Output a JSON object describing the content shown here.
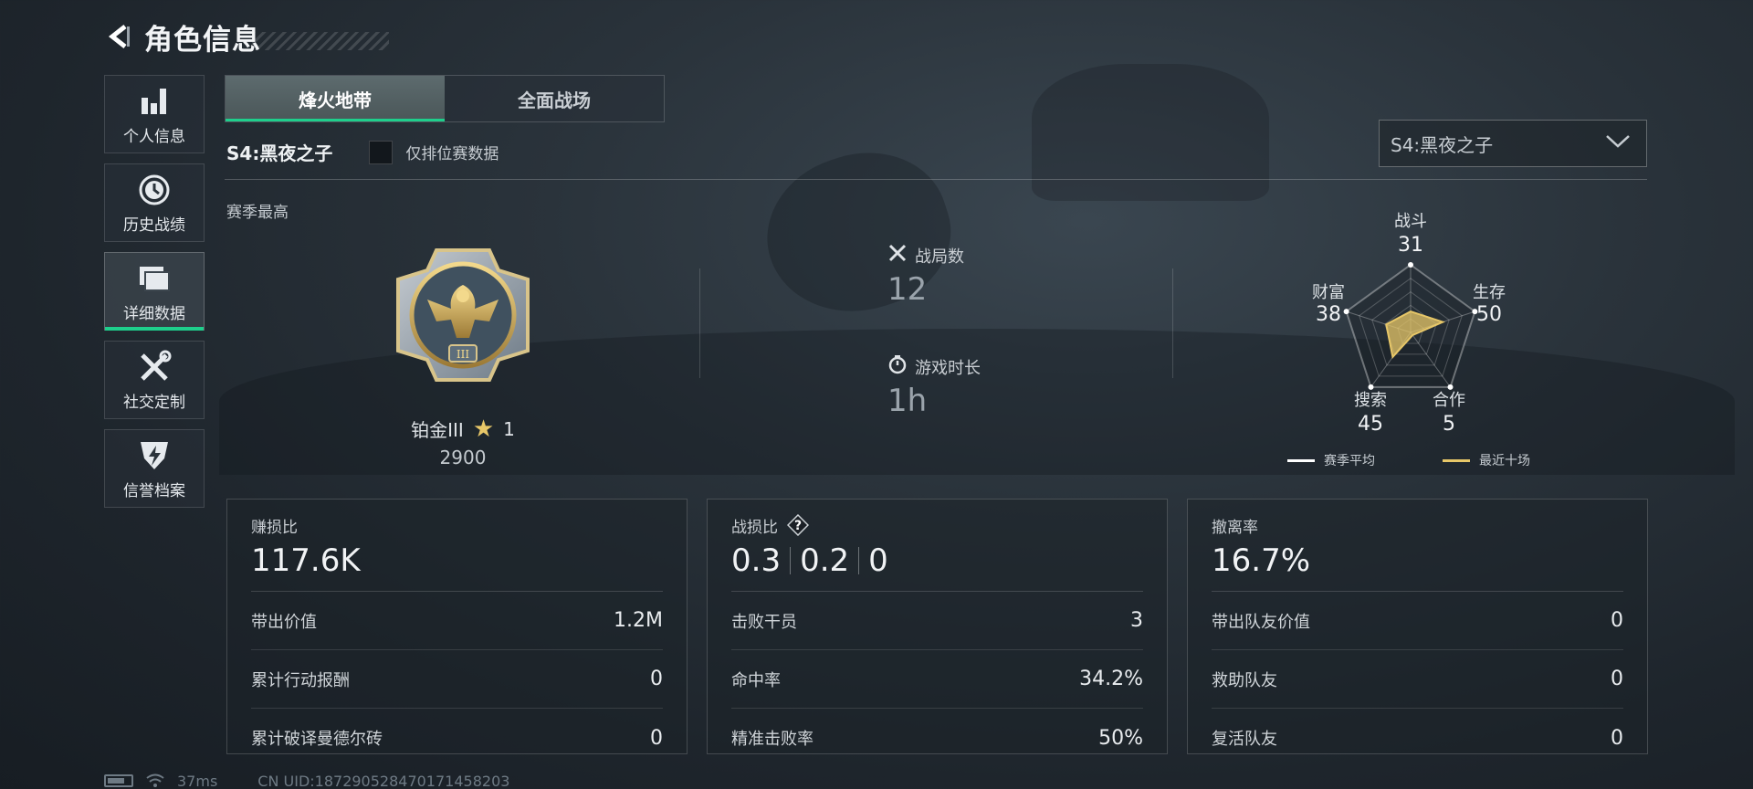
{
  "header": {
    "title": "角色信息"
  },
  "sidenav": [
    {
      "label": "个人信息",
      "icon": "bar-chart-icon"
    },
    {
      "label": "历史战绩",
      "icon": "history-clock-icon"
    },
    {
      "label": "详细数据",
      "icon": "folder-stack-icon",
      "active": true
    },
    {
      "label": "社交定制",
      "icon": "tools-icon"
    },
    {
      "label": "信誉档案",
      "icon": "shield-lightning-icon"
    }
  ],
  "tabs": [
    {
      "label": "烽火地带",
      "active": true
    },
    {
      "label": "全面战场",
      "active": false
    }
  ],
  "season": {
    "label": "S4:黑夜之子",
    "ranked_only_label": "仅排位赛数据",
    "selected": "S4:黑夜之子"
  },
  "section_title": "赛季最高",
  "rank": {
    "name": "铂金III",
    "stars": "1",
    "score": "2900"
  },
  "match_stats": {
    "matches_label": "战局数",
    "matches_value": "12",
    "playtime_label": "游戏时长",
    "playtime_value": "1h"
  },
  "radar": {
    "axes": [
      {
        "label": "战斗",
        "value": "31"
      },
      {
        "label": "生存",
        "value": "50"
      },
      {
        "label": "合作",
        "value": "5"
      },
      {
        "label": "搜索",
        "value": "45"
      },
      {
        "label": "财富",
        "value": "38"
      }
    ],
    "legend": [
      {
        "label": "赛季平均",
        "color": "#ffffff"
      },
      {
        "label": "最近十场",
        "color": "#e7c768"
      }
    ]
  },
  "cards": [
    {
      "title": "赚损比",
      "big": "117.6K",
      "rows": [
        {
          "label": "带出价值",
          "value": "1.2M"
        },
        {
          "label": "累计行动报酬",
          "value": "0"
        },
        {
          "label": "累计破译曼德尔砖",
          "value": "0"
        }
      ]
    },
    {
      "title": "战损比",
      "big_parts": [
        "0.3",
        "0.2",
        "0"
      ],
      "rows": [
        {
          "label": "击败干员",
          "value": "3"
        },
        {
          "label": "命中率",
          "value": "34.2%"
        },
        {
          "label": "精准击败率",
          "value": "50%"
        }
      ]
    },
    {
      "title": "撤离率",
      "big": "16.7%",
      "rows": [
        {
          "label": "带出队友价值",
          "value": "0"
        },
        {
          "label": "救助队友",
          "value": "0"
        },
        {
          "label": "复活队友",
          "value": "0"
        }
      ]
    }
  ],
  "statusbar": {
    "ping": "37ms",
    "uid": "CN UID:187290528470171458203"
  },
  "colors": {
    "accent": "#1ecf8c",
    "gold": "#e7c768"
  }
}
